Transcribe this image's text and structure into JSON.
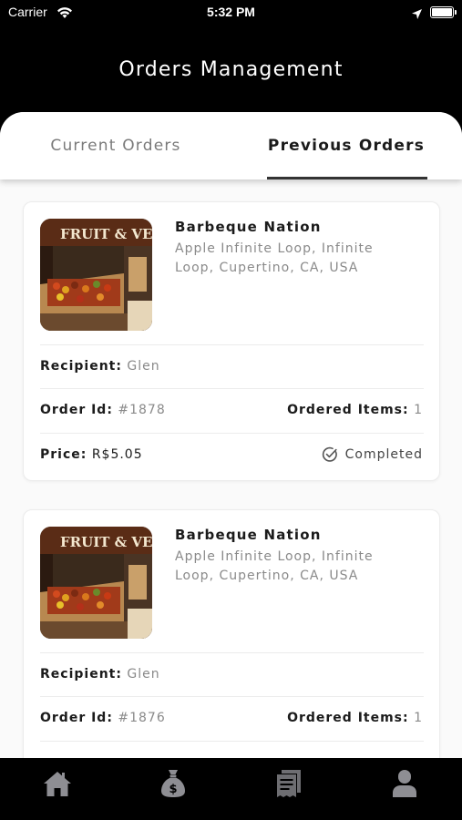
{
  "status_bar": {
    "carrier": "Carrier",
    "time": "5:32 PM"
  },
  "header": {
    "title": "Orders Management"
  },
  "tabs": [
    {
      "label": "Current Orders",
      "active": false
    },
    {
      "label": "Previous Orders",
      "active": true
    }
  ],
  "orders": [
    {
      "store_name": "Barbeque Nation",
      "address_line1": "Apple Infinite Loop, Infinite",
      "address_line2": "Loop, Cupertino, CA, USA",
      "thumb_label": "FRUIT & VEG",
      "recipient_label": "Recipient:",
      "recipient": "Glen",
      "order_id_label": "Order Id:",
      "order_id": "#1878",
      "items_label": "Ordered Items:",
      "items": "1",
      "price_label": "Price:",
      "price": "R$5.05",
      "status": "Completed"
    },
    {
      "store_name": "Barbeque Nation",
      "address_line1": "Apple Infinite Loop, Infinite",
      "address_line2": "Loop, Cupertino, CA, USA",
      "thumb_label": "FRUIT & VEG",
      "recipient_label": "Recipient:",
      "recipient": "Glen",
      "order_id_label": "Order Id:",
      "order_id": "#1876",
      "items_label": "Ordered Items:",
      "items": "1"
    }
  ],
  "bottom_nav": [
    {
      "icon": "home-icon"
    },
    {
      "icon": "money-bag-icon"
    },
    {
      "icon": "receipt-icon"
    },
    {
      "icon": "user-icon"
    }
  ],
  "colors": {
    "header_bg": "#000000",
    "nav_icon": "#8e8e93",
    "text_primary": "#1b1b1b",
    "text_secondary": "#8a8a8a"
  }
}
